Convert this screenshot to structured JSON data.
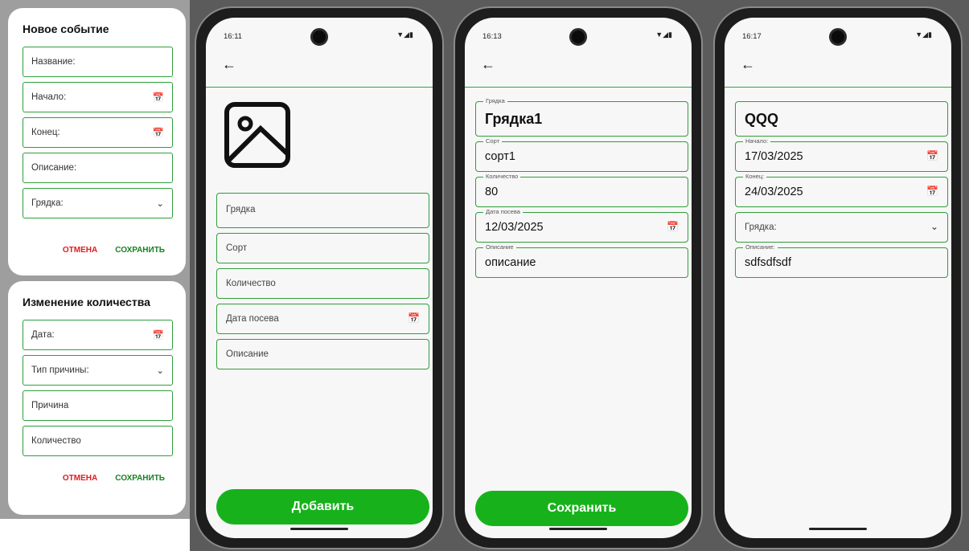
{
  "dialog_new_event": {
    "title": "Новое событие",
    "name_placeholder": "Название:",
    "start_placeholder": "Начало:",
    "end_placeholder": "Конец:",
    "description_placeholder": "Описание:",
    "bed_placeholder": "Грядка:",
    "cancel_label": "ОТМЕНА",
    "save_label": "СОХРАНИТЬ"
  },
  "dialog_change_quantity": {
    "title": "Изменение количества",
    "date_placeholder": "Дата:",
    "reason_type_placeholder": "Тип причины:",
    "reason_placeholder": "Причина",
    "quantity_placeholder": "Количество",
    "cancel_label": "ОТМЕНА",
    "save_label": "СОХРАНИТЬ"
  },
  "phone1": {
    "time": "16:11",
    "fields": {
      "bed": "Грядка",
      "variety": "Сорт",
      "quantity": "Количество",
      "sow_date": "Дата посева",
      "description": "Описание"
    },
    "add_label": "Добавить"
  },
  "phone2": {
    "time": "16:13",
    "bed_label": "Грядка",
    "bed_value": "Грядка1",
    "variety_label": "Сорт",
    "variety_value": "сорт1",
    "quantity_label": "Количество",
    "quantity_value": "80",
    "sow_date_label": "Дата посева",
    "sow_date_value": "12/03/2025",
    "description_label": "Описание",
    "description_value": "описание",
    "save_label": "Сохранить"
  },
  "phone3": {
    "time": "16:17",
    "title_value": "QQQ",
    "start_label": "Начало:",
    "start_value": "17/03/2025",
    "end_label": "Конец:",
    "end_value": "24/03/2025",
    "bed_placeholder": "Грядка:",
    "description_label": "Описание:",
    "description_value": "sdfsdfsdf"
  },
  "colors": {
    "accent_green": "#17b21b",
    "outline_green": "#2e9e3a",
    "cancel_red": "#e21b1b"
  }
}
